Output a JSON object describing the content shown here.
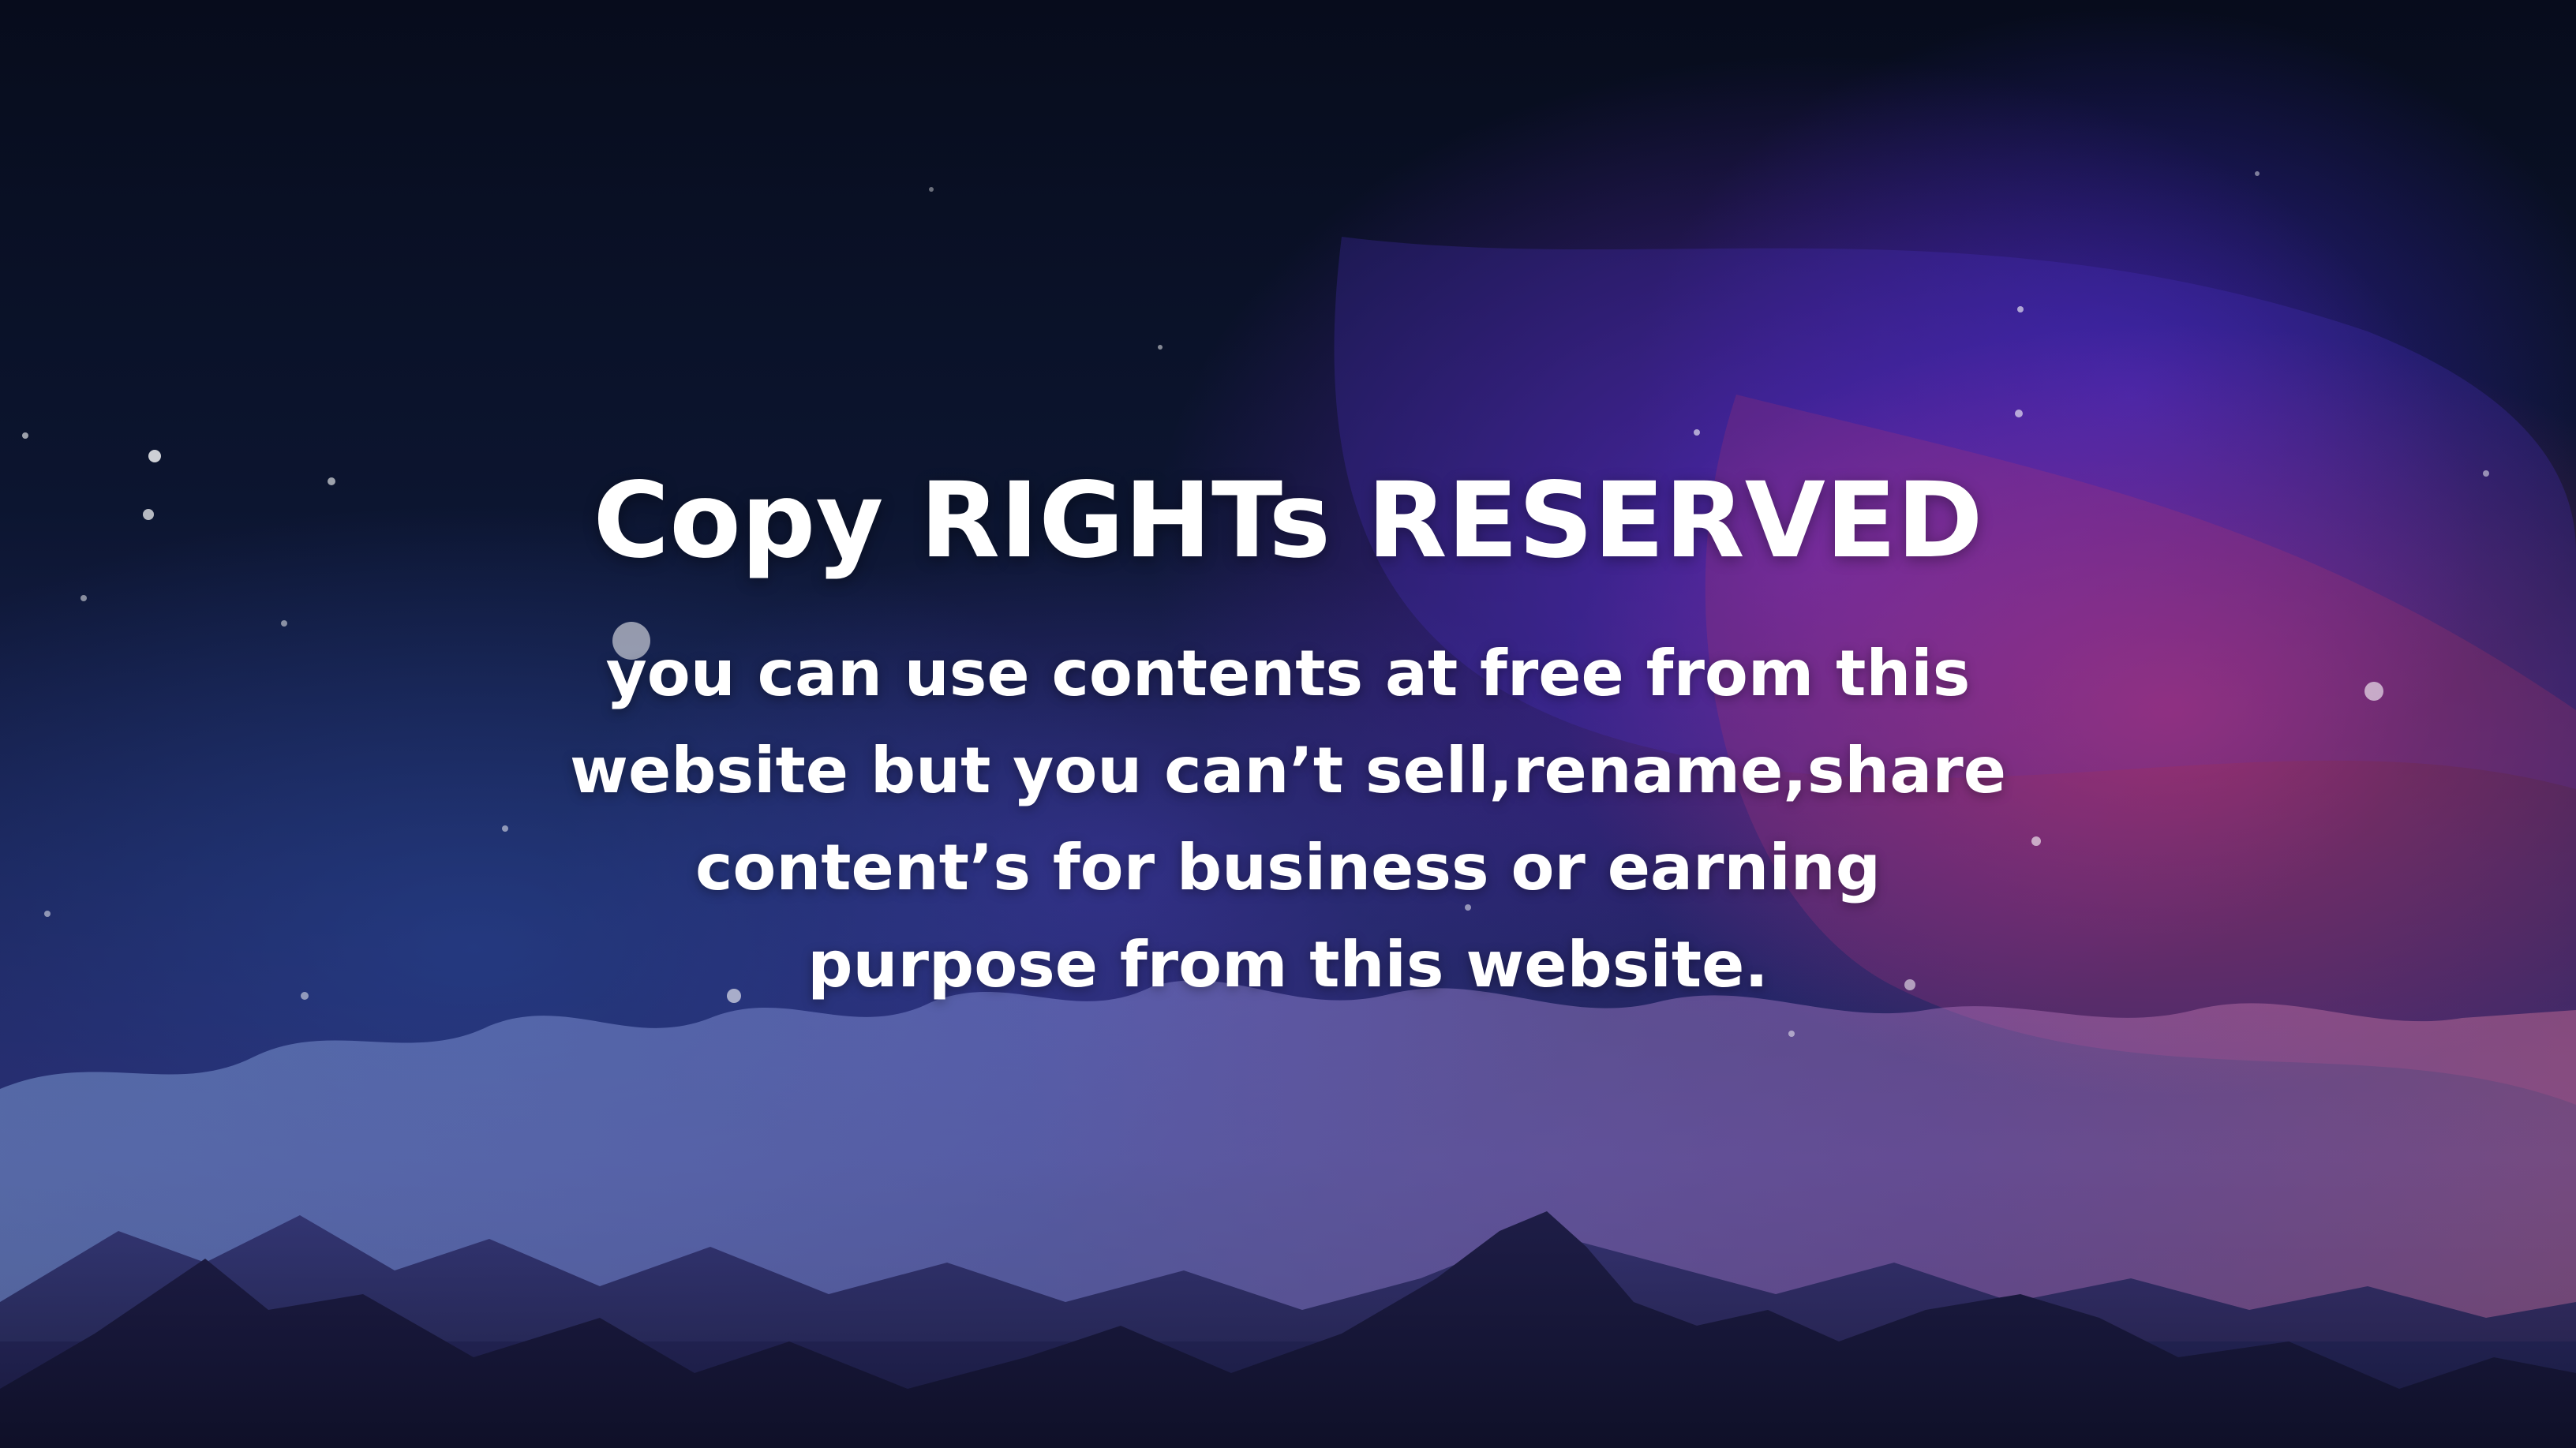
{
  "notice": {
    "title": "Copy RIGHTs RESERVED",
    "body": "you can use contents at free from this website but you can’t sell,rename,share content’s for business or earning purpose from this website."
  },
  "background": {
    "description_colors": {
      "sky_top": "#070c1c",
      "sky_mid": "#1a2356",
      "nebula_purple": "#6e28d2",
      "nebula_pink": "#e63c78",
      "cloud_blue": "#5c78b8",
      "mountain": "#141530"
    }
  }
}
